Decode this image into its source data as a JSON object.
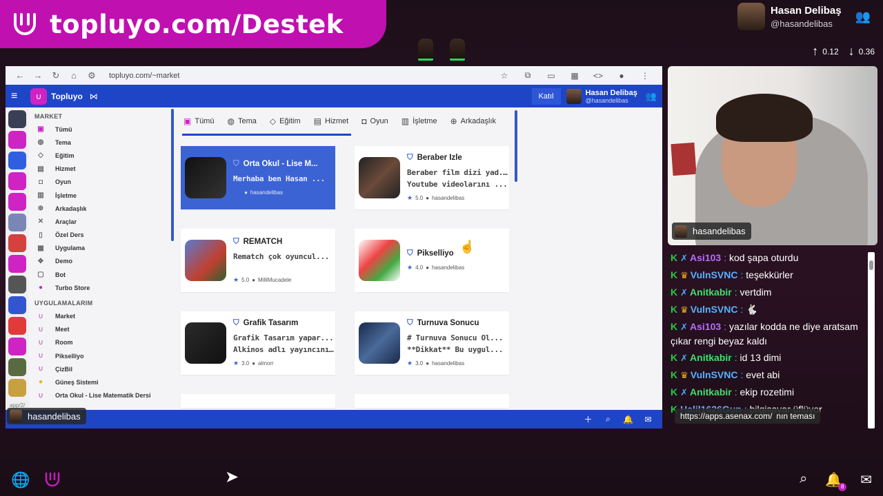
{
  "overlay": {
    "banner_text": "topluyo.com/Destek",
    "user_name": "Hasan Delibaş",
    "user_handle": "@hasandelibas",
    "net_up": "0.12",
    "net_down": "0.36"
  },
  "browser": {
    "url": "topluyo.com/~market",
    "app_name": "Topluyo",
    "join_label": "Katıl",
    "header_user_name": "Hasan Delibaş",
    "header_user_handle": "@hasandelibas",
    "status_url": "app/2/",
    "sidebar": {
      "market_heading": "MARKET",
      "market_items": [
        {
          "label": "Tümü",
          "icon": "bag-icon"
        },
        {
          "label": "Tema",
          "icon": "palette-icon"
        },
        {
          "label": "Eğitim",
          "icon": "graduation-icon"
        },
        {
          "label": "Hizmet",
          "icon": "briefcase-icon"
        },
        {
          "label": "Oyun",
          "icon": "gamepad-icon"
        },
        {
          "label": "İşletme",
          "icon": "building-icon"
        },
        {
          "label": "Arkadaşlık",
          "icon": "user-plus-icon"
        },
        {
          "label": "Araçlar",
          "icon": "tools-icon"
        },
        {
          "label": "Özel Ders",
          "icon": "book-icon"
        },
        {
          "label": "Uygulama",
          "icon": "grid-icon"
        },
        {
          "label": "Demo",
          "icon": "move-icon"
        },
        {
          "label": "Bot",
          "icon": "robot-icon"
        },
        {
          "label": "Turbo Store",
          "icon": "store-icon"
        }
      ],
      "apps_heading": "UYGULAMALARIM",
      "app_items": [
        "Market",
        "Meet",
        "Room",
        "Pikselliyo",
        "ÇizBil",
        "Güneş Sistemi",
        "Orta Okul - Lise Matematik Dersi"
      ]
    },
    "tabs": [
      {
        "label": "Tümü",
        "icon": "bag-icon"
      },
      {
        "label": "Tema",
        "icon": "palette-icon"
      },
      {
        "label": "Eğitim",
        "icon": "graduation-icon"
      },
      {
        "label": "Hizmet",
        "icon": "briefcase-icon"
      },
      {
        "label": "Oyun",
        "icon": "gamepad-icon"
      },
      {
        "label": "İşletme",
        "icon": "building-icon"
      },
      {
        "label": "Arkadaşlık",
        "icon": "user-plus-icon"
      }
    ],
    "cards": [
      {
        "title": "Orta Okul - Lise M...",
        "desc1": "Merhaba ben Hasan ...",
        "desc2": "",
        "rating": "",
        "author": "hasandelibas"
      },
      {
        "title": "Beraber İzle",
        "desc1": "Beraber film dizi yad...",
        "desc2": "Youtube videolarını ...",
        "rating": "5.0",
        "author": "hasandelibas"
      },
      {
        "title": "REMATCH",
        "desc1": "Rematch çok oyuncul...",
        "desc2": "",
        "rating": "5.0",
        "author": "MilliMucadele"
      },
      {
        "title": "Pikselliyo",
        "desc1": "",
        "desc2": "",
        "rating": "4.0",
        "author": "hasandelibas"
      },
      {
        "title": "Grafik Tasarım",
        "desc1": "Grafik Tasarım yapar...",
        "desc2": "Alkinos adlı yayıncını...",
        "rating": "3.0",
        "author": "almorr"
      },
      {
        "title": "Turnuva Sonucu",
        "desc1": "# Turnuva Sonucu Ol...",
        "desc2": "**Dikkat** Bu uygul...",
        "rating": "3.0",
        "author": "hasandelibas"
      }
    ],
    "name_tag": "hasandelibas"
  },
  "webcam": {
    "name_tag": "hasandelibas"
  },
  "chat": {
    "messages": [
      {
        "user": "Asi103",
        "color": "#b56cff",
        "badge": "sword",
        "text": "kod şapa oturdu"
      },
      {
        "user": "VulnSVNC",
        "color": "#57b2ff",
        "badge": "crown",
        "text": "teşekkürler"
      },
      {
        "user": "Anitkabir",
        "color": "#3fe06a",
        "badge": "sword",
        "text": "vertdim"
      },
      {
        "user": "VulnSVNC",
        "color": "#57b2ff",
        "badge": "crown",
        "text": "🐇"
      },
      {
        "user": "Asi103",
        "color": "#b56cff",
        "badge": "sword",
        "text": "yazılar kodda ne diye aratsam çıkar rengi beyaz kaldı"
      },
      {
        "user": "Anitkabir",
        "color": "#3fe06a",
        "badge": "sword",
        "text": "id 13 dimi"
      },
      {
        "user": "VulnSVNC",
        "color": "#57b2ff",
        "badge": "crown",
        "text": "evet abi"
      },
      {
        "user": "Anitkabir",
        "color": "#3fe06a",
        "badge": "sword",
        "text": "ekip rozetimi"
      },
      {
        "user": "Halil1626Gun",
        "color": "#6fa8ff",
        "badge": "",
        "text": "bilgisayar üflüyor"
      }
    ],
    "link_tooltip": "https://apps.asenax.com/",
    "trailing_text": "nın teması"
  },
  "colors": {
    "brand_pink": "#c010b0",
    "app_blue": "#1f45c7"
  }
}
